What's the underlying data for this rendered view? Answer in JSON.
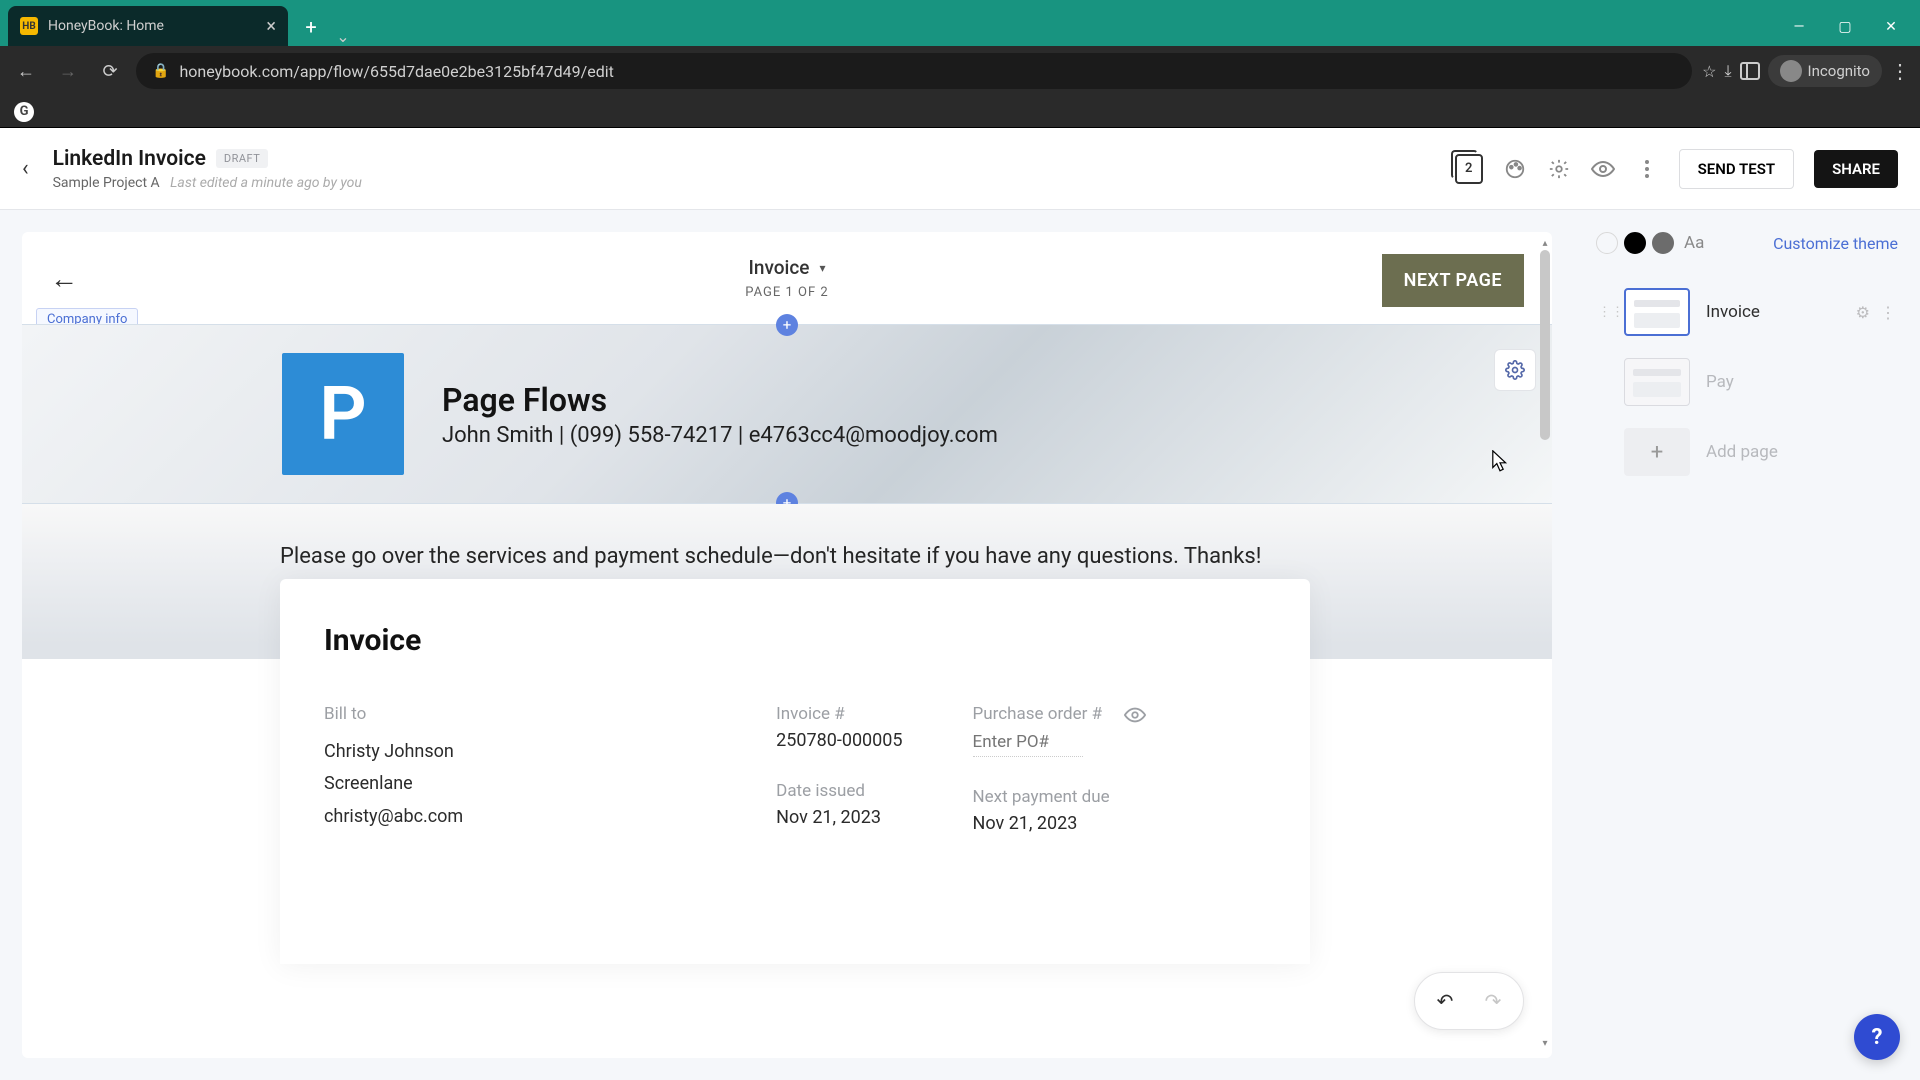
{
  "browser": {
    "tab_title": "HoneyBook: Home",
    "url": "honeybook.com/app/flow/655d7dae0e2be3125bf47d49/edit",
    "incognito_label": "Incognito",
    "favicon_letter": "HB"
  },
  "header": {
    "title": "LinkedIn Invoice",
    "badge": "DRAFT",
    "project": "Sample Project A",
    "last_edited": "Last edited a minute ago by you",
    "page_count": "2",
    "send_test": "SEND TEST",
    "share": "SHARE"
  },
  "canvas": {
    "tab_label": "Invoice",
    "page_counter": "PAGE 1 OF 2",
    "next_page": "NEXT PAGE",
    "company_info_tag": "Company info",
    "hero": {
      "avatar_letter": "P",
      "company": "Page Flows",
      "contact": "John Smith | (099) 558-74217 | e4763cc4@moodjoy.com"
    },
    "intro_text": "Please go over the services and payment schedule—don't hesitate if you have any questions. Thanks!",
    "invoice": {
      "title": "Invoice",
      "billto_label": "Bill to",
      "bill_name": "Christy Johnson",
      "bill_company": "Screenlane",
      "bill_email": "christy@abc.com",
      "invoice_num_label": "Invoice #",
      "invoice_num": "250780-000005",
      "po_label": "Purchase order #",
      "po_placeholder": "Enter PO#",
      "date_issued_label": "Date issued",
      "date_issued": "Nov 21, 2023",
      "next_payment_label": "Next payment due",
      "next_payment": "Nov 21, 2023"
    }
  },
  "sidebar": {
    "customize_label": "Customize theme",
    "pages": [
      {
        "label": "Invoice"
      },
      {
        "label": "Pay"
      }
    ],
    "add_page": "Add page"
  },
  "help": "?"
}
